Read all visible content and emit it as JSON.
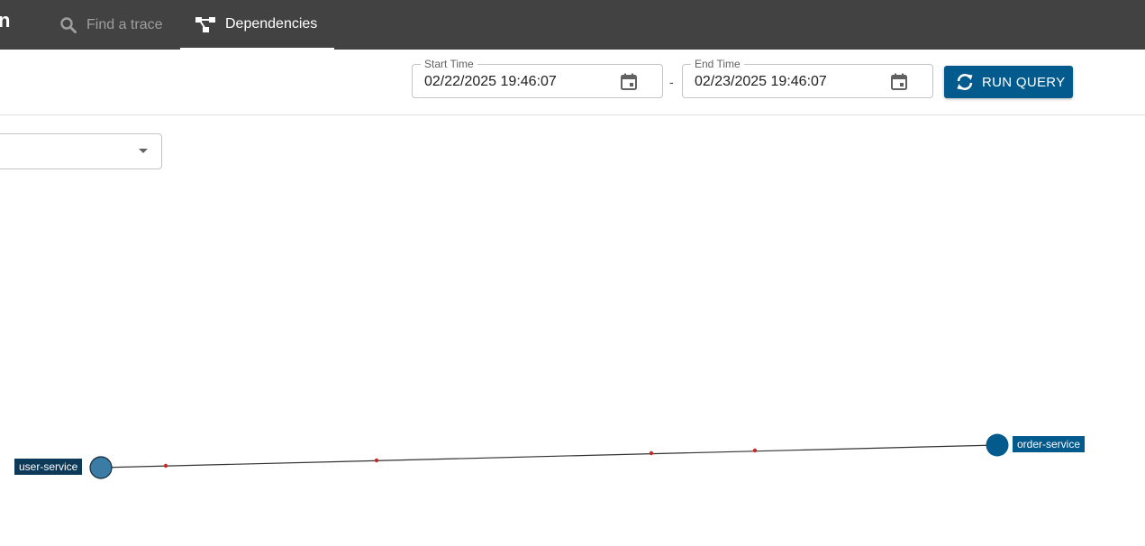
{
  "header": {
    "brand_fragment": "n",
    "tabs": [
      {
        "label": "Find a trace",
        "icon": "search-icon",
        "active": false
      },
      {
        "label": "Dependencies",
        "icon": "dependencies-icon",
        "active": true
      }
    ]
  },
  "query": {
    "start_time": {
      "label": "Start Time",
      "value": "02/22/2025 19:46:07"
    },
    "separator": "-",
    "end_time": {
      "label": "End Time",
      "value": "02/23/2025 19:46:07"
    },
    "run_button": {
      "label": "RUN QUERY",
      "icon": "refresh-icon"
    }
  },
  "filter_select": {
    "value": "",
    "icon": "dropdown-arrow-icon"
  },
  "graph": {
    "nodes": [
      {
        "name": "user-service",
        "color": "#3a7ca5",
        "label_bg": "#0e3a5a"
      },
      {
        "name": "order-service",
        "color": "#035a8d",
        "label_bg": "#035a8d"
      }
    ],
    "edge": {
      "from": "user-service",
      "to": "order-service",
      "color": "#333333",
      "particle_color": "#c62828"
    }
  },
  "colors": {
    "topbar": "#424242",
    "accent": "#035a8d"
  }
}
